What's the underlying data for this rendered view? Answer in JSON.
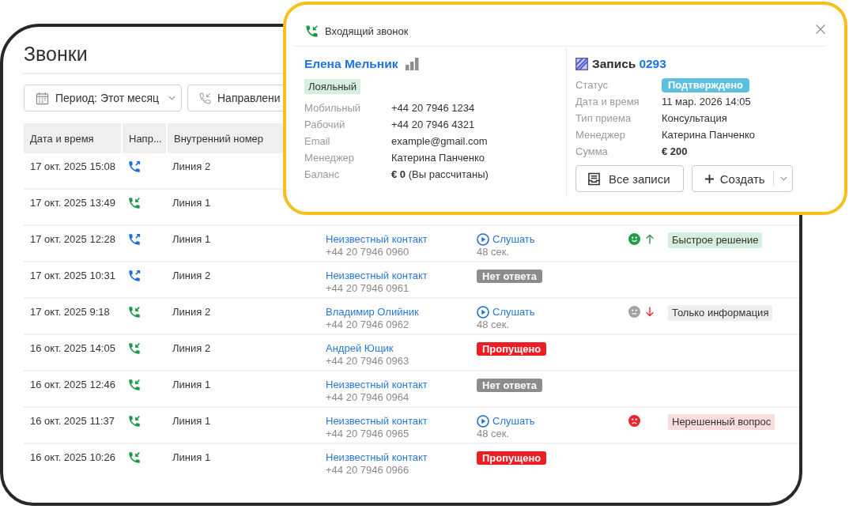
{
  "page": {
    "title": "Звонки"
  },
  "filters": [
    {
      "kind": "period",
      "label": "Период: Этот месяц"
    },
    {
      "kind": "direction",
      "label": "Направлени"
    }
  ],
  "table": {
    "columns": [
      "Дата и время",
      "Напр...",
      "Внутренний номер"
    ],
    "rows": [
      {
        "kind": "outgoing",
        "datetime": "17 окт. 2025 15:08",
        "line": "Линия 2"
      },
      {
        "kind": "incoming",
        "datetime": "17 окт. 2025 13:49",
        "line": "Линия 1"
      },
      {
        "kind": "outgoing",
        "datetime": "17 окт. 2025 12:28",
        "line": "Линия 1",
        "contact": {
          "name": "Неизвестный контакт",
          "phone": "+44 20 7946 0960"
        },
        "status": {
          "kind": "listen",
          "label": "Слушать",
          "duration": "48 сек."
        },
        "sentiment": {
          "kind": "positive"
        },
        "trend": {
          "kind": "up"
        },
        "tag": {
          "label": "Быстрое решение",
          "color": "#d6eedd"
        }
      },
      {
        "kind": "outgoing",
        "datetime": "17 окт. 2025 10:31",
        "line": "Линия 2",
        "contact": {
          "name": "Неизвестный контакт",
          "phone": "+44 20 7946 0961"
        },
        "status": {
          "kind": "no_answer",
          "label": "Нет ответа"
        }
      },
      {
        "kind": "incoming",
        "datetime": "17 окт. 2025 9:18",
        "line": "Линия 2",
        "contact": {
          "name": "Владимир Олийник",
          "phone": "+44 20 7946 0962"
        },
        "status": {
          "kind": "listen",
          "label": "Слушать",
          "duration": "48 сек."
        },
        "sentiment": {
          "kind": "neutral"
        },
        "trend": {
          "kind": "down"
        },
        "tag": {
          "label": "Только информация",
          "color": "#eeeeee"
        }
      },
      {
        "kind": "incoming",
        "datetime": "16 окт. 2025 14:05",
        "line": "Линия 2",
        "contact": {
          "name": "Андрей Ющик",
          "phone": "+44 20 7946 0963"
        },
        "status": {
          "kind": "missed",
          "label": "Пропущено"
        }
      },
      {
        "kind": "incoming",
        "datetime": "16 окт. 2025 12:46",
        "line": "Линия 1",
        "contact": {
          "name": "Неизвестный контакт",
          "phone": "+44 20 7946 0964"
        },
        "status": {
          "kind": "no_answer",
          "label": "Нет ответа"
        }
      },
      {
        "kind": "incoming",
        "datetime": "16 окт. 2025 11:37",
        "line": "Линия 1",
        "contact": {
          "name": "Неизвестный контакт",
          "phone": "+44 20 7946 0965"
        },
        "status": {
          "kind": "listen",
          "label": "Слушать",
          "duration": "48 сек."
        },
        "sentiment": {
          "kind": "negative"
        },
        "tag": {
          "label": "Нерешенный вопрос",
          "color": "#fcdcdd"
        }
      },
      {
        "kind": "incoming",
        "datetime": "16 окт. 2025 10:26",
        "line": "Линия 1",
        "contact": {
          "name": "Неизвестный контакт",
          "phone": "+44 20 7946 0966"
        },
        "status": {
          "kind": "missed",
          "label": "Пропущено"
        }
      }
    ]
  },
  "popup": {
    "title": "Входящий звонок",
    "contact": {
      "name": "Елена Мельник",
      "badge": "Лояльный",
      "fields": [
        {
          "label": "Мобильный",
          "value": "+44 20 7946 1234"
        },
        {
          "label": "Рабочий",
          "value": "+44 20 7946 4321"
        },
        {
          "label": "Email",
          "value": "example@gmail.com"
        },
        {
          "label": "Менеджер",
          "value": "Катерина Панченко"
        },
        {
          "label": "Баланс",
          "value": "**€ 0** (Вы рассчитаны)"
        }
      ]
    },
    "record": {
      "title": "Запись",
      "number": "0293",
      "fields": [
        {
          "label": "Статус",
          "value": "Подтверждено",
          "kind": "badge"
        },
        {
          "label": "Дата и время",
          "value": "11 мар. 2026 14:05",
          "kind": "text"
        },
        {
          "label": "Тип приема",
          "value": "Консультация",
          "kind": "text"
        },
        {
          "label": "Менеджер",
          "value": "Катерина Панченко",
          "kind": "text"
        },
        {
          "label": "Сумма",
          "value": "€ 200",
          "kind": "amount"
        }
      ],
      "buttons": [
        {
          "kind": "list",
          "label": "Все записи"
        },
        {
          "kind": "create",
          "label": "Создать"
        }
      ]
    }
  }
}
